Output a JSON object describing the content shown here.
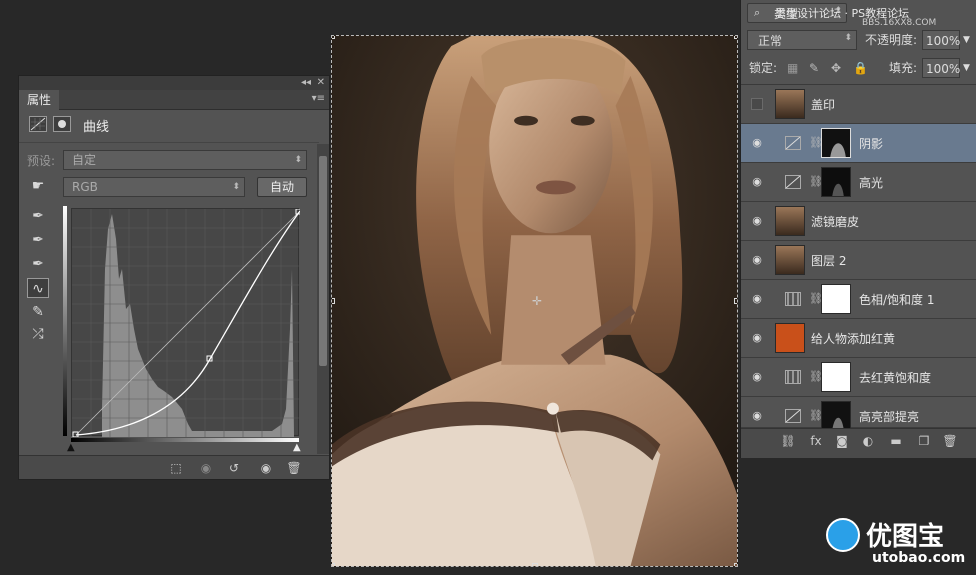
{
  "properties_panel": {
    "tab_label": "属性",
    "collapse_glyph": "◂◂",
    "close_glyph": "✕",
    "menu_glyph": "▾≡",
    "adjustment_title": "曲线",
    "preset_label": "预设:",
    "preset_value": "自定",
    "channel_value": "RGB",
    "auto_button": "自动"
  },
  "layers_panel": {
    "search_value": "类型",
    "blend_mode": "正常",
    "opacity_label": "不透明度:",
    "opacity_value": "100%",
    "lock_label": "锁定:",
    "fill_label": "填充:",
    "fill_value": "100%",
    "layers": [
      {
        "name": "盖印",
        "visible": false,
        "kind": "photo"
      },
      {
        "name": "阴影",
        "visible": true,
        "kind": "curves-mask",
        "selected": true
      },
      {
        "name": "高光",
        "visible": true,
        "kind": "curves-mask"
      },
      {
        "name": "滤镜磨皮",
        "visible": true,
        "kind": "photo"
      },
      {
        "name": "图层 2",
        "visible": true,
        "kind": "photo"
      },
      {
        "name": "色相/饱和度 1",
        "visible": true,
        "kind": "hue-white"
      },
      {
        "name": "给人物添加红黄",
        "visible": true,
        "kind": "orange-fill"
      },
      {
        "name": "去红黄饱和度",
        "visible": true,
        "kind": "hue-white"
      },
      {
        "name": "高亮部提亮",
        "visible": true,
        "kind": "curves-mask"
      }
    ]
  },
  "watermark": {
    "top_text": "思缘设计论坛 · PS教程论坛",
    "top_sub": "BBS.16XX8.COM",
    "brand_cn": "优图宝",
    "brand_url": "utobao.com"
  },
  "colors": {
    "panel_bg": "#535353",
    "selected_row": "#697a8f",
    "orange_fill": "#c9501a",
    "app_bg": "#282828"
  }
}
